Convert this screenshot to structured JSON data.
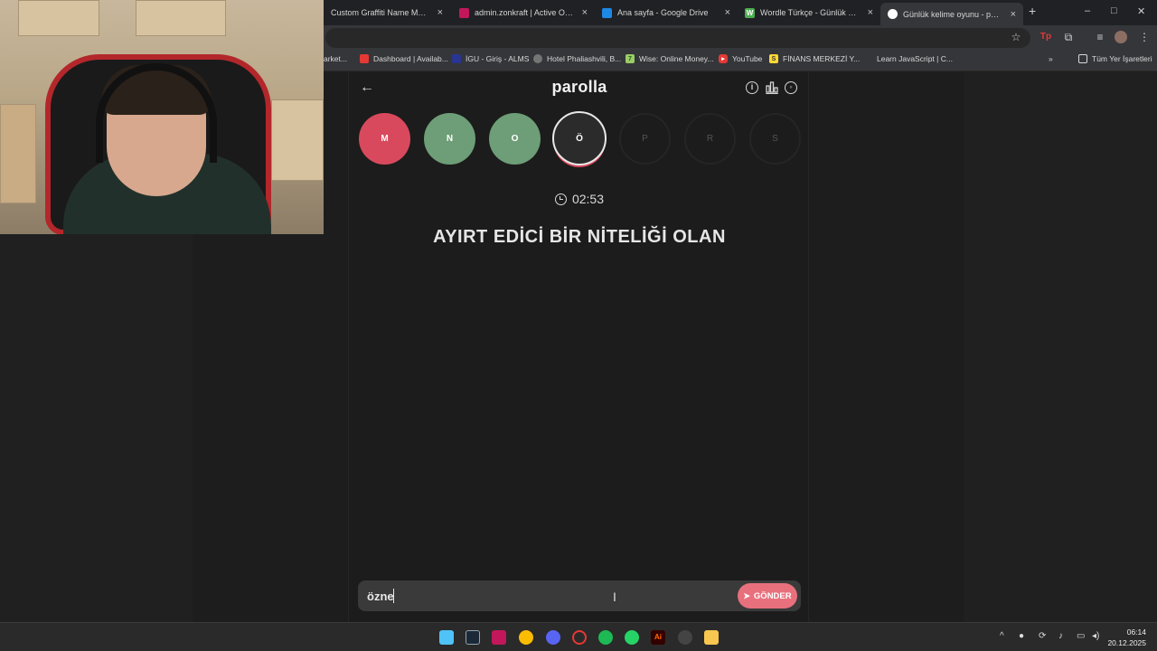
{
  "browser": {
    "tabs": [
      {
        "title": "Custom Graffiti Name Metal Si",
        "fav_color": "#888888"
      },
      {
        "title": "admin.zonkraft | Active Orders",
        "fav_color": "#c2185b"
      },
      {
        "title": "Ana sayfa - Google Drive",
        "fav_color": "#1e88e5"
      },
      {
        "title": "Wordle Türkçe - Günlük Kelime",
        "fav_color": "#4caf50"
      },
      {
        "title": "Günlük kelime oyunu - parolla",
        "fav_color": "#ffffff"
      }
    ],
    "new_tab": "+",
    "close": "×",
    "bookmarks": [
      {
        "label": "arket...",
        "fav_color": "#35363a"
      },
      {
        "label": "Dashboard | Availab...",
        "fav_color": "#e53935"
      },
      {
        "label": "İGU - Giriş - ALMS",
        "fav_color": "#3949ab"
      },
      {
        "label": "Hotel Phaliashvili, B...",
        "fav_color": "#757575"
      },
      {
        "label": "Wise: Online Money...",
        "fav_color": "#9ccc65"
      },
      {
        "label": "YouTube",
        "fav_color": "#e53935"
      },
      {
        "label": "FİNANS MERKEZİ Y...",
        "fav_color": "#fdd835"
      },
      {
        "label": "Learn JavaScript | C...",
        "fav_color": "#35363a"
      },
      {
        "label": "Tüm Yer İşaretleri",
        "fav_color": "#35363a"
      }
    ]
  },
  "game": {
    "logo": "parolla",
    "letters": [
      {
        "char": "M",
        "state": "red"
      },
      {
        "char": "N",
        "state": "green"
      },
      {
        "char": "O",
        "state": "green"
      },
      {
        "char": "Ö",
        "state": "current"
      },
      {
        "char": "P",
        "state": "pending"
      },
      {
        "char": "R",
        "state": "pending"
      },
      {
        "char": "S",
        "state": "pending"
      }
    ],
    "timer": "02:53",
    "clue": "AYIRT EDİCİ BİR NİTELİĞİ OLAN",
    "answer_value": "özne",
    "send_label": "GÖNDER"
  },
  "colors": {
    "red": "#d9495d",
    "green": "#6d9e77",
    "send": "#e8707d"
  },
  "taskbar": {
    "time": "06:14",
    "date": "20.12.2025"
  }
}
